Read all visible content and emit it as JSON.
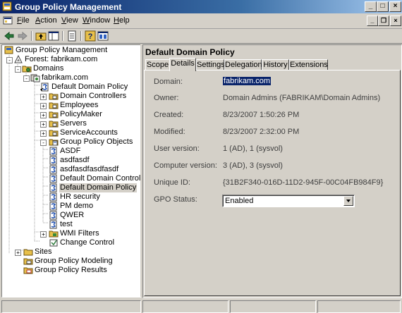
{
  "window": {
    "title": "Group Policy Management"
  },
  "menu": {
    "items": [
      {
        "label": "File"
      },
      {
        "label": "Action"
      },
      {
        "label": "View"
      },
      {
        "label": "Window"
      },
      {
        "label": "Help"
      }
    ]
  },
  "toolbar": {
    "buttons": [
      "back-icon",
      "forward-icon",
      "up-folder-icon",
      "show-tree-icon",
      "properties-icon",
      "help-icon",
      "console-icon"
    ]
  },
  "tree": {
    "root": "Group Policy Management",
    "forest": "Forest: fabrikam.com",
    "domains": "Domains",
    "domain": "fabrikam.com",
    "domain_children": [
      "Default Domain Policy",
      "Domain Controllers",
      "Employees",
      "PolicyMaker",
      "Servers",
      "ServiceAccounts",
      "Group Policy Objects"
    ],
    "gpo_children": [
      "ASDF",
      "asdfasdf",
      "asdfasdfasdfasdf",
      "Default Domain Controlle",
      "Default Domain Policy",
      "HR security",
      "PM demo",
      "QWER",
      "test"
    ],
    "wmi_filters": "WMI Filters",
    "change_control": "Change Control",
    "sites": "Sites",
    "modeling": "Group Policy Modeling",
    "results": "Group Policy Results"
  },
  "details": {
    "title": "Default Domain Policy",
    "tabs": [
      {
        "label": "Scope",
        "active": false
      },
      {
        "label": "Details",
        "active": true
      },
      {
        "label": "Settings",
        "active": false
      },
      {
        "label": "Delegation",
        "active": false
      },
      {
        "label": "History",
        "active": false
      },
      {
        "label": "Extensions",
        "active": false
      }
    ],
    "fields": [
      {
        "label": "Domain:",
        "value": "fabrikam.com"
      },
      {
        "label": "Owner:",
        "value": "Domain Admins (FABRIKAM\\Domain Admins)"
      },
      {
        "label": "Created:",
        "value": "8/23/2007 1:50:26 PM"
      },
      {
        "label": "Modified:",
        "value": "8/23/2007 2:32:00 PM"
      },
      {
        "label": "User version:",
        "value": "1 (AD), 1 (sysvol)"
      },
      {
        "label": "Computer version:",
        "value": "3 (AD), 3 (sysvol)"
      },
      {
        "label": "Unique ID:",
        "value": "{31B2F340-016D-11D2-945F-00C04FB984F9}"
      }
    ],
    "gpo_status_label": "GPO Status:",
    "gpo_status_value": "Enabled"
  },
  "colors": {
    "selection": "#0a246a",
    "titlebar_start": "#0a246a",
    "titlebar_end": "#a6caf0",
    "face": "#d4d0c8"
  }
}
